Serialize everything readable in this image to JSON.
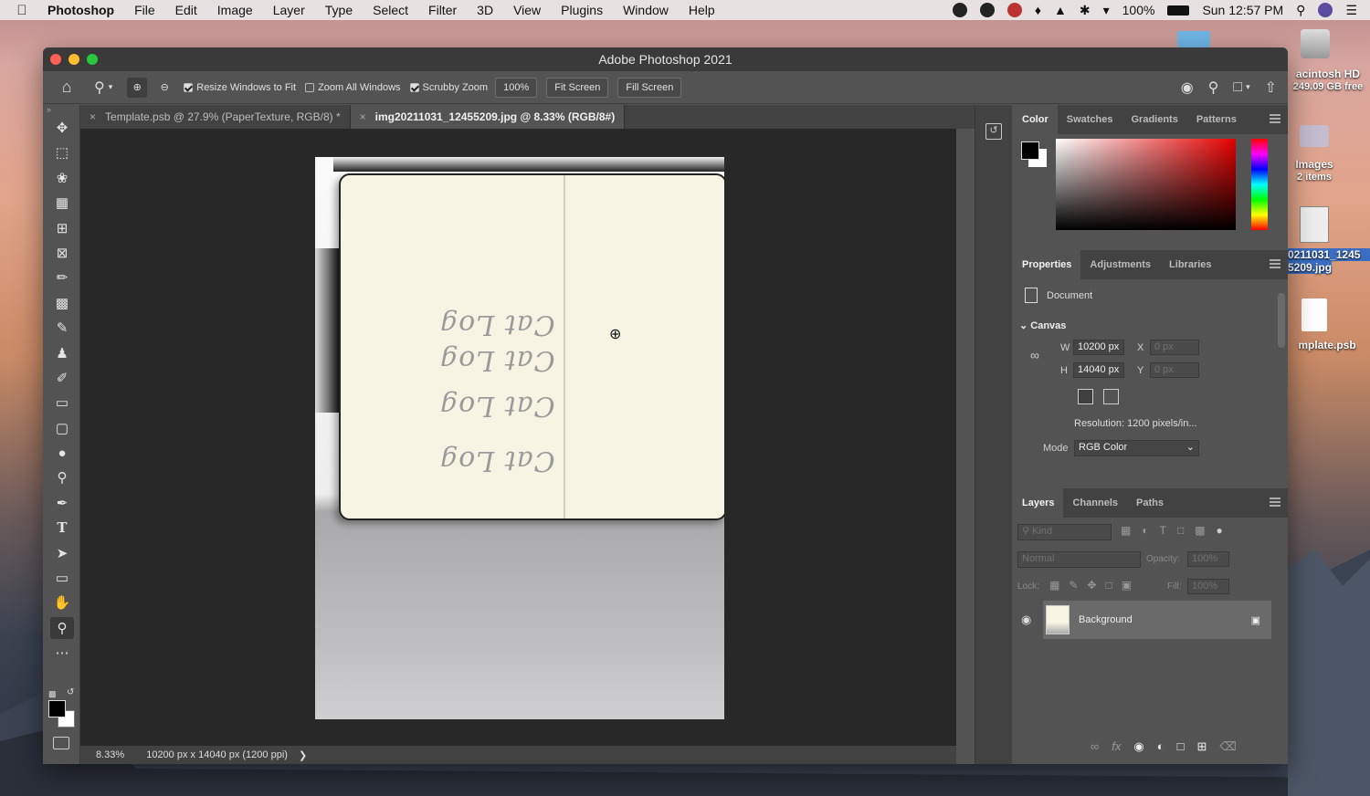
{
  "menubar": {
    "app_name": "Photoshop",
    "items": [
      "File",
      "Edit",
      "Image",
      "Layer",
      "Type",
      "Select",
      "Filter",
      "3D",
      "View",
      "Plugins",
      "Window",
      "Help"
    ],
    "battery": "100%",
    "clock": "Sun 12:57 PM"
  },
  "desktop": {
    "hd_name": "acintosh HD",
    "hd_free": "249.09 GB free",
    "images_name": "Images",
    "images_count": "2 items",
    "file1_line1": "0211031_1245",
    "file1_line2": "5209.jpg",
    "file2": "mplate.psb"
  },
  "window": {
    "title": "Adobe Photoshop 2021"
  },
  "options": {
    "resize_windows": "Resize Windows to Fit",
    "zoom_all": "Zoom All Windows",
    "scrubby": "Scrubby Zoom",
    "zoom_value": "100%",
    "fit_screen": "Fit Screen",
    "fill_screen": "Fill Screen"
  },
  "tabs": [
    {
      "label": "Template.psb @ 27.9% (PaperTexture, RGB/8) *"
    },
    {
      "label": "img20211031_12455209.jpg @ 8.33% (RGB/8#)"
    }
  ],
  "document": {
    "script_text": "Cat Log"
  },
  "statusbar": {
    "zoom": "8.33%",
    "dims": "10200 px x 14040 px (1200 ppi)",
    "arrow": "❯"
  },
  "color_panel": {
    "tabs": [
      "Color",
      "Swatches",
      "Gradients",
      "Patterns"
    ],
    "fg_color": "#000000",
    "bg_color": "#ffffff",
    "hue_color": "#e60000"
  },
  "properties": {
    "tabs": [
      "Properties",
      "Adjustments",
      "Libraries"
    ],
    "document_label": "Document",
    "canvas_label": "Canvas",
    "w_label": "W",
    "w_value": "10200 px",
    "h_label": "H",
    "h_value": "14040 px",
    "x_label": "X",
    "x_value": "0 px",
    "y_label": "Y",
    "y_value": "0 px",
    "resolution": "Resolution: 1200 pixels/in...",
    "mode_label": "Mode",
    "mode_value": "RGB Color"
  },
  "layers": {
    "tabs": [
      "Layers",
      "Channels",
      "Paths"
    ],
    "kind_placeholder": "Kind",
    "blend_mode": "Normal",
    "opacity_label": "Opacity:",
    "opacity_value": "100%",
    "lock_label": "Lock:",
    "fill_label": "Fill:",
    "fill_value": "100%",
    "layer_name": "Background"
  }
}
